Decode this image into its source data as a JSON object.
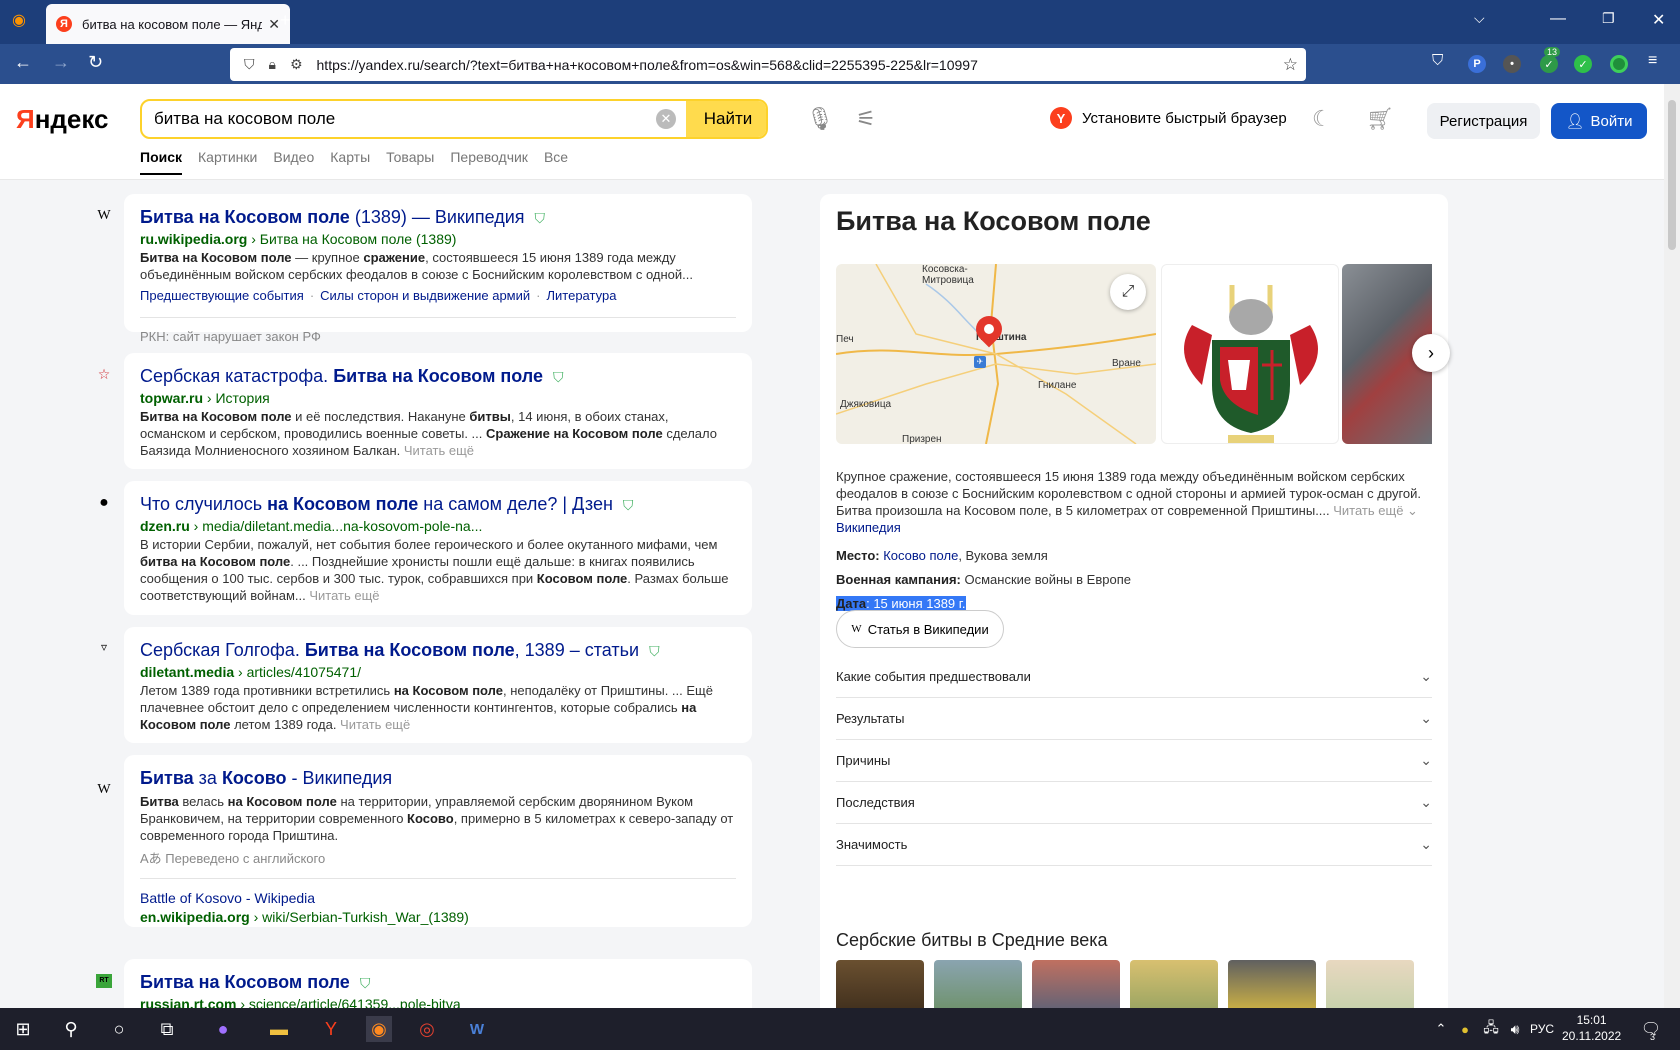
{
  "browser": {
    "tab_title": "битва на косовом поле — Яндекс",
    "tab_favicon": "Я",
    "url": "https://yandex.ru/search/?text=битва+на+косовом+поле&from=os&win=568&clid=2255395-225&lr=10997",
    "ext_badge": "13"
  },
  "header": {
    "logo_main": "Я",
    "logo_rest": "ндекс",
    "query": "битва на косовом поле",
    "search_button": "Найти",
    "promo": "Установите быстрый браузер",
    "register": "Регистрация",
    "login": "Войти",
    "tabs": [
      "Поиск",
      "Картинки",
      "Видео",
      "Карты",
      "Товары",
      "Переводчик",
      "Все"
    ]
  },
  "results": [
    {
      "icon": "W",
      "title_a": "Битва на Косовом поле",
      "title_b": " (1389) — Википедия",
      "domain": "ru.wikipedia.org",
      "path": " › Битва на Косовом поле (1389)",
      "snip_a": "Битва на Косовом поле",
      "snip_b": " — крупное ",
      "snip_c": "сражение",
      "snip_d": ", состоявшееся 15 июня 1389 года между объединённым войском сербских феодалов в союзе с Боснийским королевством с одной...",
      "links": [
        "Предшествующие события",
        "Силы сторон и выдвижение армий",
        "Литература"
      ],
      "notice": "РКН: сайт нарушает закон РФ"
    },
    {
      "icon": "☆",
      "title_a": "Сербская катастрофа. ",
      "title_b": "Битва на Косовом поле",
      "domain": "topwar.ru",
      "path": " › История",
      "snip_a": "Битва на Косовом поле",
      "snip_b": " и её последствия. Накануне ",
      "snip_c": "битвы",
      "snip_d": ", 14 июня, в обоих станах, османском и сербском, проводились военные советы. ... ",
      "snip_e": "Сражение на Косовом поле",
      "snip_f": " сделало Баязида Молниеносного хозяином Балкан. ",
      "more": "Читать ещё"
    },
    {
      "icon": "●",
      "title_a": "Что случилось ",
      "title_b": "на Косовом поле",
      "title_c": " на самом деле? | Дзен",
      "domain": "dzen.ru",
      "path": " › media/diletant.media...na-kosovom-pole-na...",
      "snip_a": "В истории Сербии, пожалуй, нет события более героического и более окутанного мифами, чем ",
      "snip_b": "битва на Косовом поле",
      "snip_c": ". ... Позднейшие хронисты пошли ещё дальше: в книгах появились сообщения о 100 тыс. сербов и 300 тыс. турок, собравшихся при ",
      "snip_d": "Косовом поле",
      "snip_e": ". Размах больше соответствующий войнам... ",
      "more": "Читать ещё"
    },
    {
      "icon": "▿",
      "title_a": "Сербская Голгофа. ",
      "title_b": "Битва на Косовом поле",
      "title_c": ", 1389 – статьи",
      "domain": "diletant.media",
      "path": " › articles/41075471/",
      "snip_a": "Летом 1389 года противники встретились ",
      "snip_b": "на Косовом поле",
      "snip_c": ", неподалёку от Приштины. ... Ещё плачевнее обстоит дело с определением численности контингентов, которые собрались ",
      "snip_d": "на Косовом поле",
      "snip_e": " летом 1389 года. ",
      "more": "Читать ещё"
    },
    {
      "icon": "W",
      "title_a": "Битва",
      "title_b": " за ",
      "title_c": "Косово",
      "title_d": " - Википедия",
      "snip_a": "Битва",
      "snip_b": " велась ",
      "snip_c": "на Косовом поле",
      "snip_d": " на территории, управляемой сербским дворянином Вуком Бранковичем, на территории современного ",
      "snip_e": "Косово",
      "snip_f": ", примерно в 5 километрах к северо-западу от современного города Приштина.",
      "translated": "Переведено с английского",
      "sub_title": "Battle of Kosovo - Wikipedia",
      "sub_domain": "en.wikipedia.org",
      "sub_path": " › wiki/Serbian-Turkish_War_(1389)"
    },
    {
      "icon": "RT",
      "title_a": "Битва на Косовом поле",
      "domain": "russian.rt.com",
      "path": " › science/article/641359...pole-bitva"
    }
  ],
  "panel": {
    "title": "Битва на Косовом поле",
    "map_labels": [
      "Косовска-\nМитровица",
      "Печ",
      "Приштина",
      "Вране",
      "Гнилане",
      "Джяковица",
      "Призрен"
    ],
    "desc": "Крупное сражение, состоявшееся 15 июня 1389 года между объединённым войском сербских феодалов в союзе с Боснийским королевством с одной стороны и армией турок-осман с другой. Битва произошла на Косовом поле, в 5 километрах от современной Приштины.... ",
    "desc_more": "Читать ещё ⌄",
    "desc_src": "Википедия",
    "place_label": "Место:",
    "place_link": "Косово поле",
    "place_rest": ", Вукова земля",
    "campaign_label": "Военная кампания:",
    "campaign_value": " Османские войны в Европе",
    "date_label": "Дата",
    "date_value": "15 июня 1389 г.",
    "wiki_button": "Статья в Википедии",
    "accordion": [
      "Какие события предшествовали",
      "Результаты",
      "Причины",
      "Последствия",
      "Значимость"
    ],
    "section_title": "Сербские битвы в Средние века"
  },
  "taskbar": {
    "lang": "РУС",
    "time": "15:01",
    "date": "20.11.2022",
    "notif": "3"
  }
}
